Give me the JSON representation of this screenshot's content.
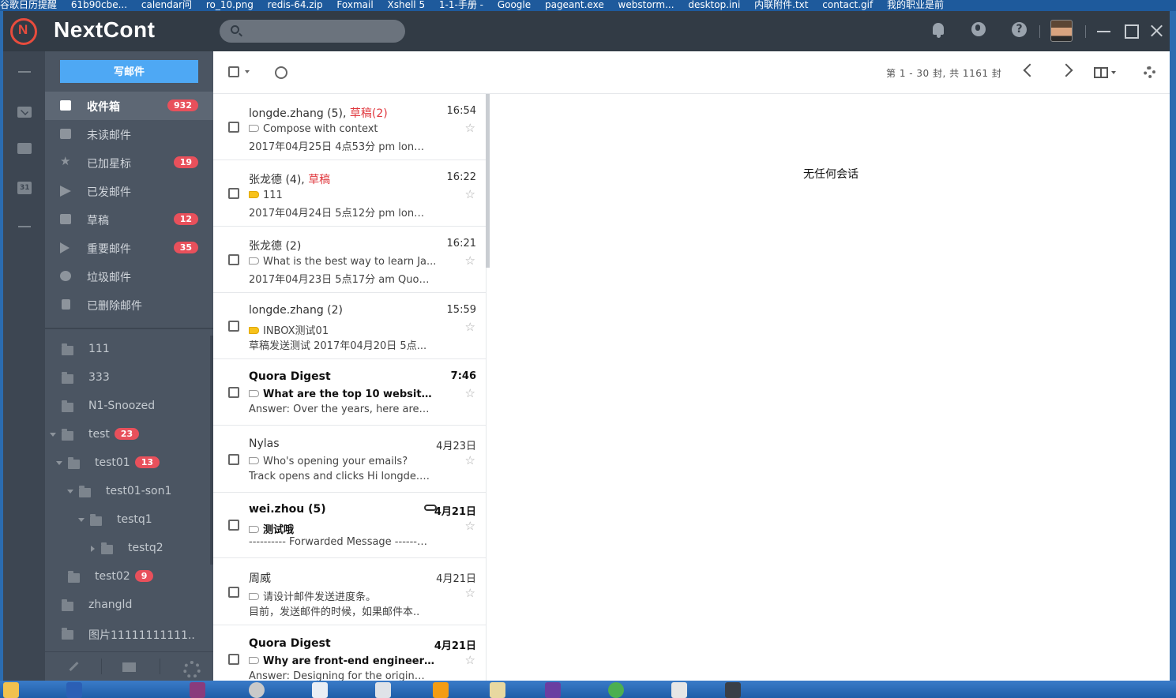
{
  "desktop": {
    "top_items": [
      "谷歌日历提醒",
      "61b90cbe...",
      "calendar问",
      "ro_10.png",
      "redis-64.zip",
      "Foxmail",
      "Xshell 5",
      "1-1-手册 -",
      "Google",
      "pageant.exe",
      "webstorm...",
      "desktop.ini",
      "内联附件.txt",
      "contact.gif",
      "我的职业是前"
    ]
  },
  "app": {
    "brand": "NextCont",
    "accent": "#e84c3d",
    "search": {
      "placeholder": "",
      "value": ""
    }
  },
  "sidebar": {
    "compose_label": "写邮件",
    "items": [
      {
        "label": "收件箱",
        "badge": "932",
        "icon": "inbox-icon"
      },
      {
        "label": "未读邮件",
        "badge": "",
        "icon": "unread-icon"
      },
      {
        "label": "已加星标",
        "badge": "19",
        "icon": "star-icon"
      },
      {
        "label": "已发邮件",
        "badge": "",
        "icon": "send-icon"
      },
      {
        "label": "草稿",
        "badge": "12",
        "icon": "draft-icon"
      },
      {
        "label": "重要邮件",
        "badge": "35",
        "icon": "important-icon"
      },
      {
        "label": "垃圾邮件",
        "badge": "",
        "icon": "spam-icon"
      },
      {
        "label": "已删除邮件",
        "badge": "",
        "icon": "trash-icon"
      }
    ],
    "folders": [
      {
        "label": "111",
        "badge": ""
      },
      {
        "label": "333",
        "badge": ""
      },
      {
        "label": "N1-Snoozed",
        "badge": ""
      },
      {
        "label": "test",
        "badge": "23"
      },
      {
        "label": "test01",
        "badge": "13"
      },
      {
        "label": "test01-son1",
        "badge": ""
      },
      {
        "label": "testq1",
        "badge": ""
      },
      {
        "label": "testq2",
        "badge": ""
      },
      {
        "label": "test02",
        "badge": "9"
      },
      {
        "label": "zhangld",
        "badge": ""
      },
      {
        "label": "图片11111111111..",
        "badge": ""
      }
    ]
  },
  "toolbar": {
    "pager": "第 1 - 30 封, 共 1161 封"
  },
  "mails": [
    {
      "from": "longde.zhang (5)",
      "sep": ", ",
      "draft": "草稿(2)",
      "time": "16:54",
      "subject": "Compose with context",
      "tag": "plain",
      "preview": "2017年04月25日 4点53分 pm longd..",
      "unread": false
    },
    {
      "from": "张龙德 (4)",
      "sep": ", ",
      "draft": "草稿",
      "time": "16:22",
      "subject": "111",
      "tag": "yellow",
      "preview": "2017年04月24日 5点12分 pm longd..",
      "unread": false
    },
    {
      "from": "张龙德 (2)",
      "sep": "",
      "draft": "",
      "time": "16:21",
      "subject": "What is the best way to learn Ja...",
      "tag": "plain",
      "preview": "2017年04月23日 5点17分 am Quor...",
      "unread": false
    },
    {
      "from": "longde.zhang (2)",
      "sep": "",
      "draft": "",
      "time": "15:59",
      "subject": "INBOX测试01",
      "tag": "yellow",
      "preview": "草稿发送测试 2017年04月20日 5点...",
      "unread": false
    },
    {
      "from": "Quora Digest",
      "sep": "",
      "draft": "",
      "time": "7:46",
      "subject": "What are the top 10 websites a ...",
      "tag": "plain",
      "preview": "Answer: Over the years, here are my..",
      "unread": true
    },
    {
      "from": "Nylas",
      "sep": "",
      "draft": "",
      "time": "4月23日",
      "subject": "Who's opening your emails?",
      "tag": "plain",
      "preview": "Track opens and clicks Hi longde.z...",
      "unread": false
    },
    {
      "from": "wei.zhou (5)",
      "sep": "",
      "draft": "",
      "time": "4月21日",
      "subject": "测试哦",
      "tag": "plain",
      "preview": "---------- Forwarded Message ---------- F...",
      "unread": true
    },
    {
      "from": "周威",
      "sep": "",
      "draft": "",
      "time": "4月21日",
      "subject": "请设计邮件发送进度条。",
      "tag": "plain",
      "preview": "目前，发送邮件的时候，如果邮件本..",
      "unread": false
    },
    {
      "from": "Quora Digest",
      "sep": "",
      "draft": "",
      "time": "4月21日",
      "subject": "Why are front-end engineers in ...",
      "tag": "plain",
      "preview": "Answer: Designing for the original w..",
      "unread": true
    }
  ],
  "reading": {
    "empty_text": "无任何会话"
  }
}
